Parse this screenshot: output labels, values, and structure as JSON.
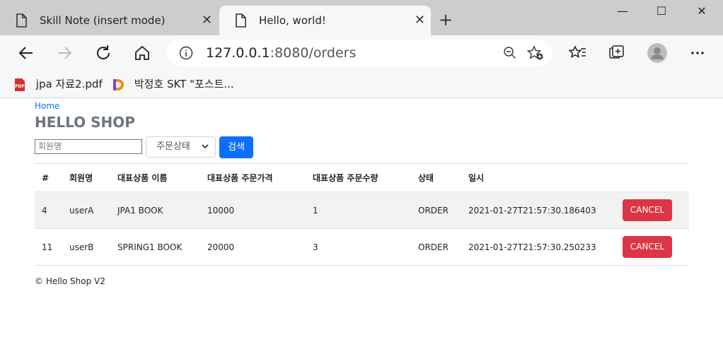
{
  "browser": {
    "tabs": [
      {
        "title": "Skill Note (insert mode)",
        "close": "✕"
      },
      {
        "title": "Hello, world!",
        "close": "✕"
      }
    ],
    "new_tab": "+",
    "window_controls": {
      "minimize": "—",
      "maximize": "☐",
      "close": "✕"
    },
    "address": {
      "host": "127.0.0.1",
      "rest": ":8080/orders"
    },
    "bookmarks": [
      {
        "label": "jpa 자료2.pdf",
        "icon": "pdf-icon"
      },
      {
        "label": "박정호 SKT \"포스트...",
        "icon": "d-icon"
      }
    ]
  },
  "page": {
    "home_link": "Home",
    "brand": "HELLO SHOP",
    "search": {
      "member_placeholder": "회원명",
      "status_select": "주문상태",
      "search_button": "검색"
    },
    "table": {
      "headers": [
        "#",
        "회원명",
        "대표상품 이름",
        "대표상품 주문가격",
        "대표상품 주문수량",
        "상태",
        "일시",
        ""
      ],
      "rows": [
        {
          "id": "4",
          "member": "userA",
          "item": "JPA1 BOOK",
          "price": "10000",
          "count": "1",
          "status": "ORDER",
          "date": "2021-01-27T21:57:30.186403",
          "action": "CANCEL"
        },
        {
          "id": "11",
          "member": "userB",
          "item": "SPRING1 BOOK",
          "price": "20000",
          "count": "3",
          "status": "ORDER",
          "date": "2021-01-27T21:57:30.250233",
          "action": "CANCEL"
        }
      ]
    },
    "footer": "© Hello Shop V2"
  },
  "colors": {
    "primary": "#0d6efd",
    "danger": "#dc3545",
    "brand": "#6c757d"
  }
}
